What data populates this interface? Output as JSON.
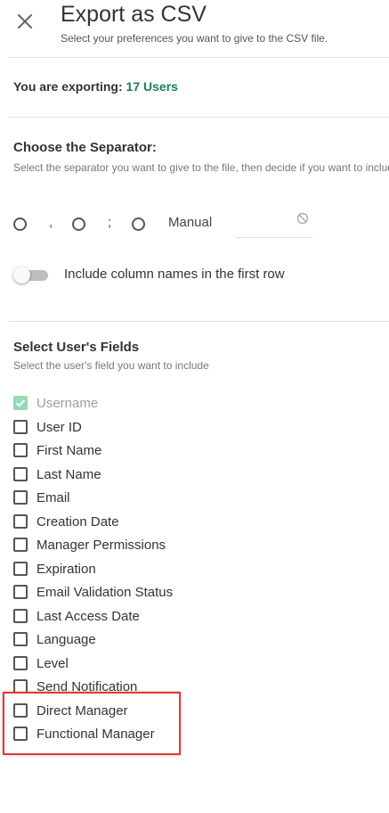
{
  "header": {
    "title": "Export as CSV",
    "subtitle": "Select your preferences you want to give to the CSV file."
  },
  "export_info": {
    "prefix": "You are exporting:",
    "count": "17 Users"
  },
  "separator": {
    "title": "Choose the Separator:",
    "description": "Select the separator you want to give to the file, then decide if you want to include column names in the first row",
    "options": [
      ",",
      ";",
      "Manual"
    ],
    "manual_value": "",
    "toggle_label": "Include column names in the first row",
    "toggle_on": false
  },
  "fields": {
    "title": "Select User's Fields",
    "description": "Select the user's field you want to include",
    "items": [
      {
        "label": "Username",
        "checked": true,
        "disabled": true
      },
      {
        "label": "User ID",
        "checked": false
      },
      {
        "label": "First Name",
        "checked": false
      },
      {
        "label": "Last Name",
        "checked": false
      },
      {
        "label": "Email",
        "checked": false
      },
      {
        "label": "Creation Date",
        "checked": false
      },
      {
        "label": "Manager Permissions",
        "checked": false
      },
      {
        "label": "Expiration",
        "checked": false
      },
      {
        "label": "Email Validation Status",
        "checked": false
      },
      {
        "label": "Last Access Date",
        "checked": false
      },
      {
        "label": "Language",
        "checked": false
      },
      {
        "label": "Level",
        "checked": false
      },
      {
        "label": "Send Notification",
        "checked": false
      },
      {
        "label": "Direct Manager",
        "checked": false
      },
      {
        "label": "Functional Manager",
        "checked": false
      }
    ]
  },
  "colors": {
    "accent": "#15805f",
    "checked_fill": "#97d8b5",
    "highlight": "#e03a3a"
  },
  "icons": {
    "close": "close-icon",
    "ban": "ban-icon",
    "check": "check-icon"
  }
}
